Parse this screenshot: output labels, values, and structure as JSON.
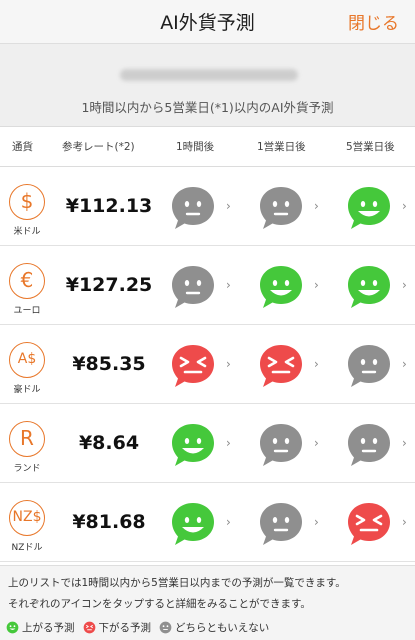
{
  "header": {
    "title": "AI外貨予測",
    "close_label": "閉じる"
  },
  "subtitle": "1時間以内から5営業日(*1)以内のAI外貨予測",
  "columns": [
    "通貨",
    "参考レート(*2)",
    "1時間後",
    "1営業日後",
    "5営業日後"
  ],
  "colors": {
    "accent": "#e8772a",
    "up": "#45c83b",
    "down": "#ee4b4b",
    "neutral": "#8f8f8f"
  },
  "rows": [
    {
      "symbol": "$",
      "name": "米ドル",
      "rate": "¥112.13",
      "predictions": [
        "neutral",
        "neutral",
        "up"
      ]
    },
    {
      "symbol": "€",
      "name": "ユーロ",
      "rate": "¥127.25",
      "predictions": [
        "neutral",
        "up",
        "up"
      ]
    },
    {
      "symbol": "A$",
      "name": "豪ドル",
      "rate": "¥85.35",
      "predictions": [
        "down",
        "down",
        "neutral"
      ]
    },
    {
      "symbol": "R",
      "name": "ランド",
      "rate": "¥8.64",
      "predictions": [
        "up",
        "neutral",
        "neutral"
      ]
    },
    {
      "symbol": "NZ$",
      "name": "NZドル",
      "rate": "¥81.68",
      "predictions": [
        "up",
        "neutral",
        "down"
      ]
    }
  ],
  "footer": {
    "note_line1": "上のリストでは1時間以内から5営業日以内までの予測が一覧できます。",
    "note_line2": "それぞれのアイコンをタップすると詳細をみることができます。",
    "legend": {
      "up": "上がる予測",
      "down": "下がる予測",
      "neutral": "どちらともいえない"
    }
  }
}
